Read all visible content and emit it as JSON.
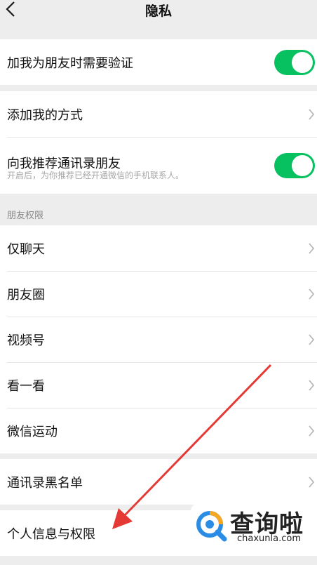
{
  "nav": {
    "title": "隐私",
    "back_icon": "chevron-left-icon"
  },
  "groups": {
    "verify": {
      "label": "加我为朋友时需要验证",
      "toggle_on": true
    },
    "add_method": {
      "label": "添加我的方式"
    },
    "recommend": {
      "label": "向我推荐通讯录朋友",
      "sublabel": "开启后，为你推荐已经开通微信的手机联系人。",
      "toggle_on": true
    }
  },
  "friend_permissions": {
    "header": "朋友权限",
    "items": [
      {
        "label": "仅聊天"
      },
      {
        "label": "朋友圈"
      },
      {
        "label": "视频号"
      },
      {
        "label": "看一看"
      },
      {
        "label": "微信运动"
      }
    ]
  },
  "blacklist": {
    "label": "通讯录黑名单"
  },
  "personal_info": {
    "label": "个人信息与权限"
  },
  "watermark": {
    "title": "查询啦",
    "domain": "chaxunla.com"
  },
  "colors": {
    "toggle_on": "#07c160",
    "background": "#ededed",
    "arrow": "#e53935"
  }
}
